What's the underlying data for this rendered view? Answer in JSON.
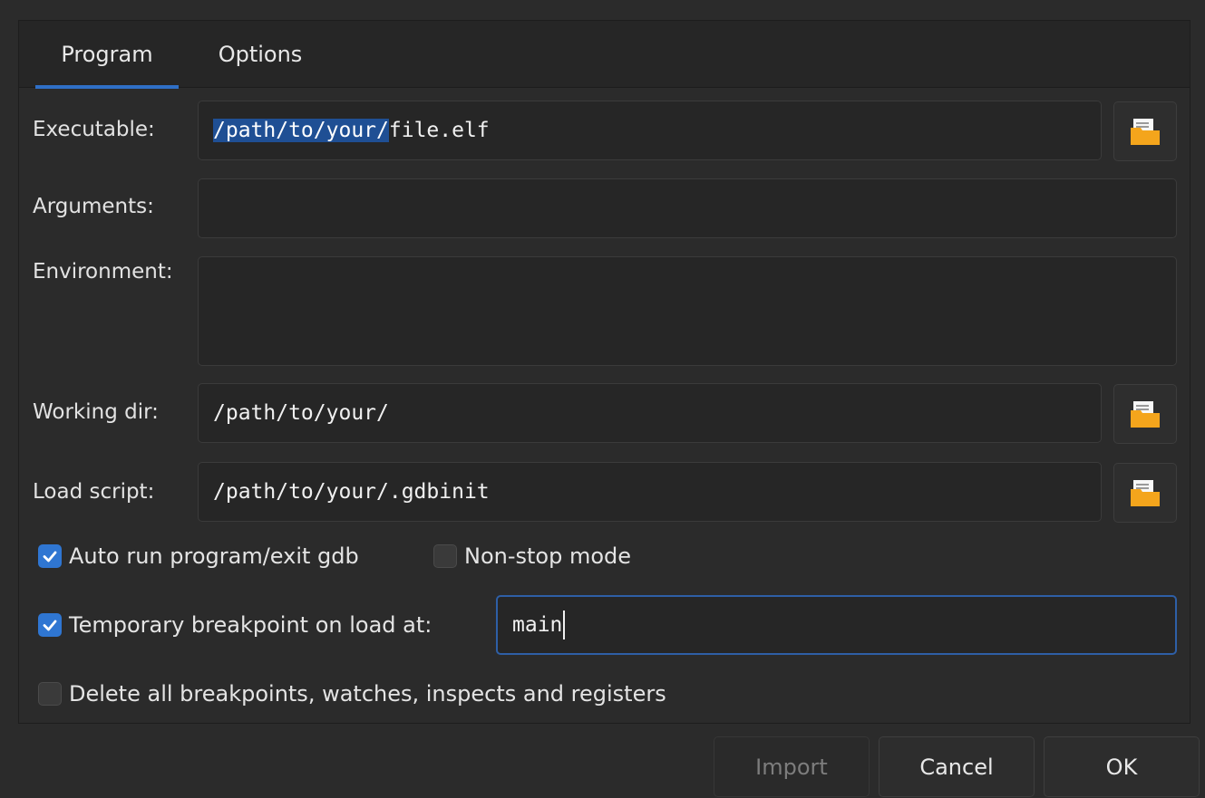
{
  "tabs": [
    {
      "label": "Program",
      "active": true
    },
    {
      "label": "Options",
      "active": false
    }
  ],
  "executable": {
    "label": "Executable:",
    "value_selected": "/path/to/your/",
    "value_rest": "file.elf"
  },
  "arguments": {
    "label": "Arguments:",
    "value": ""
  },
  "environment": {
    "label": "Environment:",
    "value": ""
  },
  "working_dir": {
    "label": "Working dir:",
    "value": "/path/to/your/"
  },
  "load_script": {
    "label": "Load script:",
    "value": "/path/to/your/.gdbinit"
  },
  "options": {
    "auto_run": {
      "label": "Auto run program/exit gdb",
      "checked": true
    },
    "non_stop": {
      "label": "Non-stop mode",
      "checked": false
    },
    "temp_breakpoint": {
      "label": "Temporary breakpoint on load at:",
      "checked": true,
      "value": "main"
    },
    "delete_all": {
      "label": "Delete all breakpoints, watches, inspects and registers",
      "checked": false
    }
  },
  "buttons": {
    "import": {
      "label": "Import",
      "enabled": false
    },
    "cancel": {
      "label": "Cancel",
      "enabled": true
    },
    "ok": {
      "label": "OK",
      "enabled": true
    }
  },
  "icons": {
    "browse": "folder-icon",
    "check": "checkmark-icon"
  },
  "colors": {
    "accent": "#2f76d2",
    "selection": "#1f4f94",
    "folder": "#f4a51c",
    "background": "#2b2b2b"
  }
}
